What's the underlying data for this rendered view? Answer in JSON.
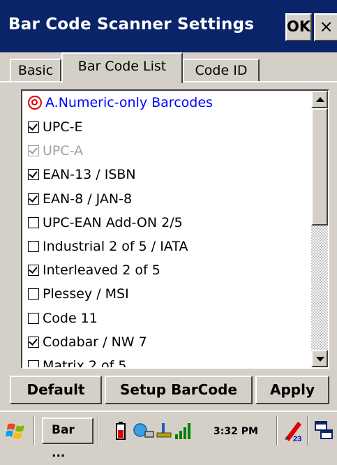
{
  "window": {
    "title": "Bar Code Scanner Settings",
    "ok_label": "OK",
    "close_label": "×"
  },
  "tabs": [
    {
      "label": "Basic",
      "active": false
    },
    {
      "label": "Bar Code List",
      "active": true
    },
    {
      "label": "Code ID",
      "active": false
    }
  ],
  "list": {
    "group_header": "A.Numeric-only Barcodes",
    "items": [
      {
        "label": "UPC-E",
        "checked": true,
        "enabled": true
      },
      {
        "label": "UPC-A",
        "checked": true,
        "enabled": false
      },
      {
        "label": "EAN-13 / ISBN",
        "checked": true,
        "enabled": true
      },
      {
        "label": "EAN-8 / JAN-8",
        "checked": true,
        "enabled": true
      },
      {
        "label": "UPC-EAN Add-ON 2/5",
        "checked": false,
        "enabled": true
      },
      {
        "label": "Industrial 2 of 5 / IATA",
        "checked": false,
        "enabled": true
      },
      {
        "label": "Interleaved 2 of 5",
        "checked": true,
        "enabled": true
      },
      {
        "label": "Plessey / MSI",
        "checked": false,
        "enabled": true
      },
      {
        "label": "Code 11",
        "checked": false,
        "enabled": true
      },
      {
        "label": "Codabar / NW 7",
        "checked": true,
        "enabled": true
      },
      {
        "label": "Matrix 2 of 5",
        "checked": false,
        "enabled": true
      }
    ]
  },
  "buttons": {
    "default_label": "Default",
    "setup_label": "Setup BarCode",
    "apply_label": "Apply"
  },
  "taskbar": {
    "task_label": "Bar ...",
    "clock": "3:32 PM",
    "icons": [
      "windows-start-icon",
      "battery-icon",
      "network-icon",
      "usb-icon",
      "signal-strength-icon",
      "input-panel-icon",
      "desktop-icon"
    ]
  },
  "colors": {
    "titlebar": "#0a246a",
    "group_header_text": "#0000ff",
    "group_icon": "#e00000",
    "face": "#d4d0c8"
  }
}
